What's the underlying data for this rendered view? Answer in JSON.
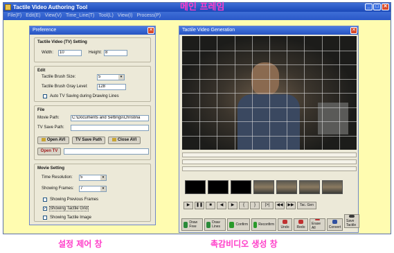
{
  "main_window": {
    "title": "Tactile Video Authoring Tool",
    "title_kr": "메인 프레임",
    "menu": [
      "File(F)",
      "Edit(E)",
      "View(V)",
      "Time_Line(T)",
      "Tool(L)",
      "View(I)",
      "Process(P)"
    ]
  },
  "preference": {
    "title": "Preference",
    "tv_group": {
      "label": "Tactile Video (TV) Setting",
      "width_label": "Width:",
      "width_value": "10",
      "height_label": "Height:",
      "height_value": "8"
    },
    "edit_group": {
      "label": "Edit",
      "brush_size_label": "Tactile Brush Size:",
      "brush_size_value": "5",
      "gray_label": "Tactile Brush Gray Level:",
      "gray_value": "128",
      "auto_save_label": "Auto TV Saving during Drawing Lines"
    },
    "file_group": {
      "label": "File",
      "movie_path_label": "Movie Path:",
      "movie_path_value": "C:\\Documents and Settings\\Christina",
      "tv_save_label": "TV Save Path:",
      "tv_save_value": "",
      "open_avi": "Open AVI",
      "tv_save_path": "TV Save Path",
      "close_avi": "Close AVI",
      "open_tv": "Open TV"
    },
    "movie_group": {
      "label": "Movie Setting",
      "time_res_label": "Time Resolution:",
      "time_res_value": "5",
      "show_frames_label": "Showing Frames:",
      "show_frames_value": "7",
      "prev_frames_label": "Showing Previous Frames",
      "grid_label": "Showing Tactile Grid",
      "image_label": "Showing Tactile Image"
    }
  },
  "generation": {
    "title": "Tactile Video Generation",
    "controls": [
      "▶",
      "❚❚",
      "■",
      "◀",
      "▶",
      "{",
      "}",
      "|>|",
      "◀◀",
      "▶▶",
      "Tac. Gen"
    ],
    "draw_buttons": [
      "Draw Free",
      "Draw Lines",
      "Confirm",
      "Reconfirm",
      "Undo",
      "Redo",
      "Erase All",
      "Convert"
    ],
    "save_label": "Save Tactile"
  },
  "labels": {
    "settings_kr": "설정 제어 창",
    "tactile_kr": "촉감비디오 생성 창"
  },
  "colors": {
    "annotation": "#ff3cc8",
    "title_blue": "#2754c2",
    "background": "#fffcb0"
  }
}
